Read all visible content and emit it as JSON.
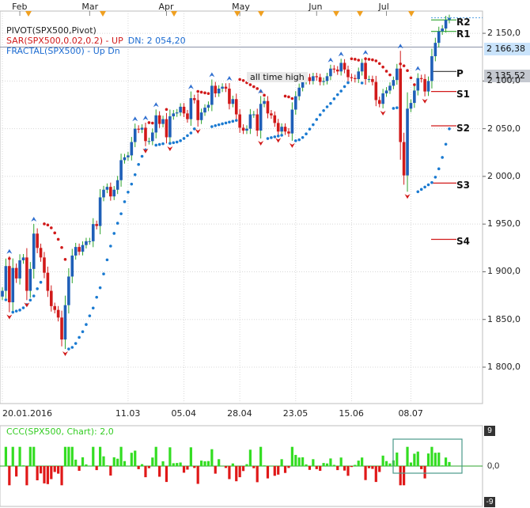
{
  "legend": {
    "pivot_label": "PIVOT(SPX500,Pivot)",
    "sar_label": "SAR(SPX500,0.02,0.2) -  UP",
    "sar_dn": "DN: 2 054,20",
    "fractal_label": "FRACTAL(SPX500) -  Up  Dn"
  },
  "annotation": {
    "all_time_high": "all time high"
  },
  "price_tags": {
    "current": "2 166,38",
    "all_time_high": "2 135,52"
  },
  "indicator": {
    "label": "CCC(SPX500, Chart): 2,0",
    "ticks": [
      "9",
      "0,0",
      "-9"
    ]
  },
  "colors": {
    "up": "#2ca32c",
    "down": "#d11a1a",
    "sar": "#1a7ad1",
    "sar_down": "#d11a1a",
    "fractal": "#2f6fd0",
    "osc_up": "#33dd22",
    "osc_down": "#e01818",
    "grid": "#d8d8d8"
  },
  "chart_data": {
    "type": "candlestick",
    "symbol": "SPX500",
    "y_ticks": [
      "2 150,0",
      "2 100,0",
      "2 050,0",
      "2 000,0",
      "1 950,0",
      "1 900,0",
      "1 850,0",
      "1 800,0"
    ],
    "y_tick_values": [
      2150,
      2100,
      2050,
      2000,
      1950,
      1900,
      1850,
      1800
    ],
    "ylim": [
      1770,
      2205
    ],
    "month_labels": [
      "Feb",
      "Mar",
      "Apr",
      "May",
      "Jun",
      "Jul"
    ],
    "date_labels": [
      "20.01.2016",
      "11.03",
      "05.04",
      "28.04",
      "23.05",
      "15.06",
      "08.07"
    ],
    "pivot_levels": [
      {
        "name": "R2",
        "value": 2164
      },
      {
        "name": "R1",
        "value": 2152
      },
      {
        "name": "P",
        "value": 2110
      },
      {
        "name": "S1",
        "value": 2089
      },
      {
        "name": "S2",
        "value": 2053
      },
      {
        "name": "S3",
        "value": 1993
      },
      {
        "name": "S4",
        "value": 1934
      }
    ],
    "all_time_high": 2135.52,
    "closes": [
      1880,
      1906,
      1868,
      1904,
      1893,
      1912,
      1915,
      1880,
      1903,
      1940,
      1925,
      1915,
      1899,
      1880,
      1864,
      1860,
      1852,
      1829,
      1865,
      1895,
      1917,
      1926,
      1921,
      1928,
      1932,
      1932,
      1950,
      1948,
      1978,
      1986,
      1989,
      1979,
      1986,
      1996,
      2017,
      2020,
      2022,
      2036,
      2050,
      2049,
      2051,
      2037,
      2037,
      2046,
      2064,
      2055,
      2060,
      2041,
      2063,
      2066,
      2067,
      2073,
      2066,
      2060,
      2082,
      2080,
      2059,
      2067,
      2072,
      2075,
      2095,
      2087,
      2092,
      2094,
      2092,
      2076,
      2081,
      2065,
      2051,
      2048,
      2050,
      2065,
      2065,
      2048,
      2076,
      2079,
      2066,
      2064,
      2056,
      2047,
      2052,
      2047,
      2045,
      2070,
      2084,
      2093,
      2100,
      2104,
      2100,
      2105,
      2104,
      2099,
      2100,
      2105,
      2113,
      2112,
      2110,
      2119,
      2112,
      2104,
      2103,
      2102,
      2110,
      2119,
      2102,
      2102,
      2099,
      2080,
      2076,
      2087,
      2090,
      2095,
      2101,
      2113,
      2036,
      2001,
      2071,
      2077,
      2090,
      2103,
      2102,
      2089,
      2100,
      2126,
      2140,
      2152,
      2155,
      2164,
      2166
    ]
  }
}
